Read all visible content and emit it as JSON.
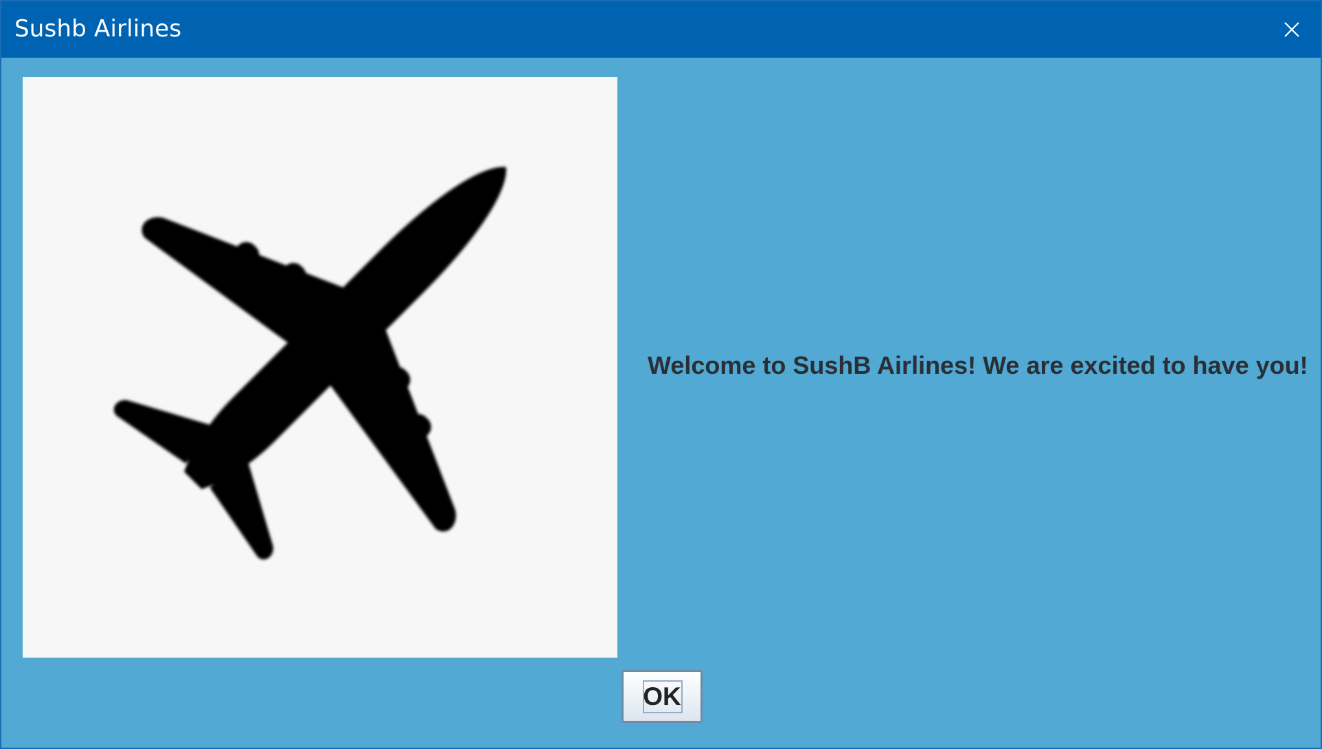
{
  "window": {
    "title": "Sushb Airlines"
  },
  "titlebar_controls": {
    "close_icon": "close-icon"
  },
  "image": {
    "icon": "airplane-icon"
  },
  "message": {
    "text": "Welcome to SushB Airlines! We are excited to have you!"
  },
  "buttons": {
    "ok_label": "OK"
  },
  "colors": {
    "titlebar": "#0063b1",
    "background": "#51a9d4",
    "image_panel": "#f7f7f7",
    "text": "#2a2f35"
  }
}
